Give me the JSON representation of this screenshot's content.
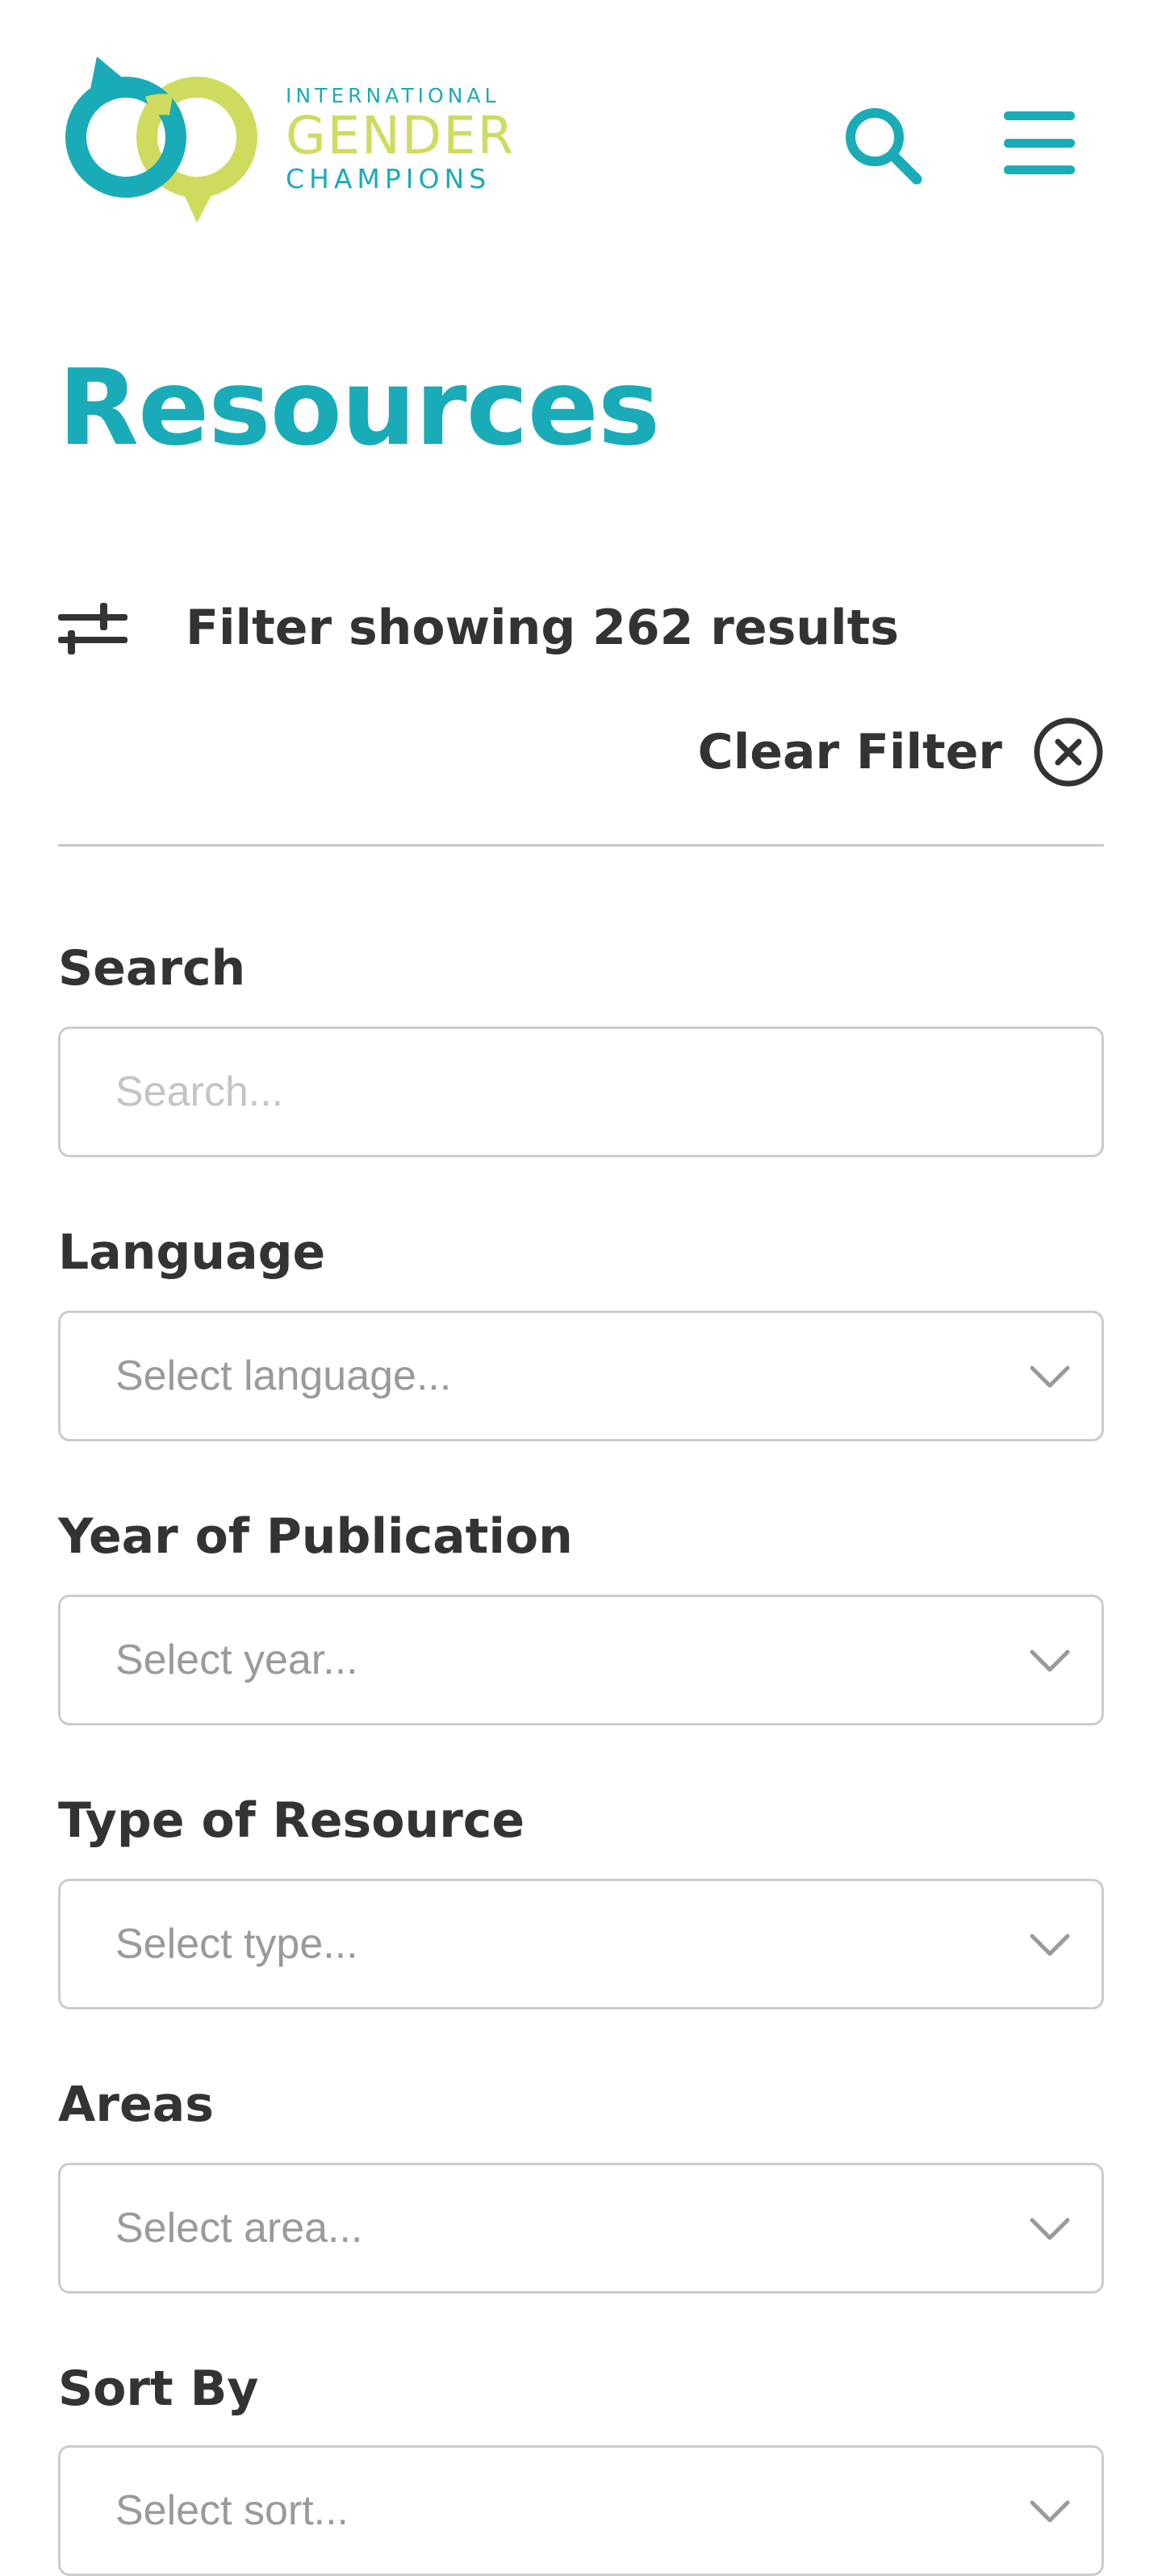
{
  "brand": {
    "line1": "INTERNATIONAL",
    "line2": "GENDER",
    "line3": "CHAMPIONS",
    "colors": {
      "teal": "#1aabb8",
      "lime": "#cfdb5e"
    }
  },
  "header": {
    "search_icon": "search-icon",
    "menu_icon": "hamburger-menu-icon"
  },
  "page": {
    "title": "Resources"
  },
  "filter": {
    "icon": "sliders-icon",
    "summary": "Filter showing 262 results",
    "clear_label": "Clear Filter",
    "clear_icon": "close-circle-icon"
  },
  "fields": {
    "search": {
      "label": "Search",
      "placeholder": "Search..."
    },
    "language": {
      "label": "Language",
      "placeholder": "Select language..."
    },
    "year": {
      "label": "Year of Publication",
      "placeholder": "Select year..."
    },
    "type": {
      "label": "Type of Resource",
      "placeholder": "Select type..."
    },
    "areas": {
      "label": "Areas",
      "placeholder": "Select area..."
    },
    "sort": {
      "label": "Sort By",
      "placeholder": "Select sort..."
    }
  }
}
